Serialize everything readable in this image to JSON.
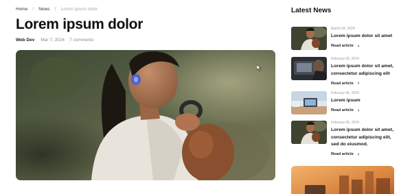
{
  "breadcrumb": {
    "home": "Home",
    "news": "News",
    "current": "Lorem ipsum dolor",
    "separator": "/"
  },
  "article": {
    "title": "Lorem ipsum dolor",
    "author": "Web Dev",
    "date": "Mar 7, 2024",
    "comments": "7 comments"
  },
  "sidebar": {
    "title": "Latest News",
    "read_label": "Read article",
    "items": [
      {
        "date": "March 04, 2024",
        "title": "Lorem ipsum dolor sit amet"
      },
      {
        "date": "February 06, 2024",
        "title": "Lorem ipsum dolor sit amet, consectetur adipiscing elit"
      },
      {
        "date": "February 06, 2024",
        "title": "Lorem ipsum"
      },
      {
        "date": "February 06, 2024",
        "title": "Lorem ipsum dolor sit amet, consectetur adipiscing elit, sed do eiusmod."
      }
    ]
  },
  "icons": {
    "chevron": "chevron-right-icon",
    "cursor": "mouse-cursor-icon"
  }
}
